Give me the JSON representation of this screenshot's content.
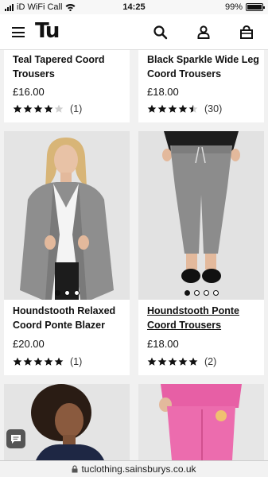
{
  "status": {
    "carrier": "iD WiFi Call",
    "time": "14:25",
    "battery": "99%",
    "battery_level": 0.99
  },
  "header": {
    "logo": "Tu",
    "icons": [
      "hamburger-menu-icon",
      "search-icon",
      "account-icon",
      "bag-icon"
    ]
  },
  "products": [
    {
      "title_line1": "Teal Tapered Coord",
      "title_line2": "Trousers",
      "price": "£16.00",
      "rating": 4,
      "rating_count": "(1)"
    },
    {
      "title_line1": "Black Sparkle Wide Leg",
      "title_line2": "Coord Trousers",
      "price": "£18.00",
      "rating": 4.5,
      "rating_count": "(30)"
    },
    {
      "title_line1": "Houndstooth Relaxed",
      "title_line2": "Coord Ponte Blazer",
      "price": "£20.00",
      "rating": 5,
      "rating_count": "(1)",
      "image_dots": 3,
      "active_dot": 1
    },
    {
      "title_line1": "Houndstooth Ponte",
      "title_line2": "Coord Trousers",
      "price": "£18.00",
      "rating": 5,
      "rating_count": "(2)",
      "image_dots": 4,
      "active_dot": 1
    }
  ],
  "url": "tuclothing.sainsburys.co.uk"
}
